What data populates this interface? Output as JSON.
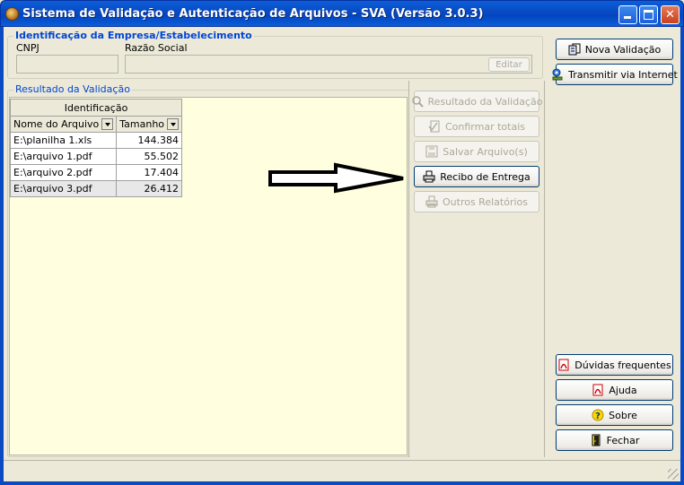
{
  "window": {
    "title": "Sistema de Validação e Autenticação de Arquivos - SVA (Versão 3.0.3)",
    "controls": {
      "minimize": "_",
      "maximize": "□",
      "close": "✕"
    }
  },
  "company_group": {
    "title": "Identificação da Empresa/Estabelecimento",
    "cnpj_label": "CNPJ",
    "cnpj_value": "",
    "razao_label": "Razão Social",
    "razao_value": "",
    "edit_button": "Editar"
  },
  "results_group": {
    "title": "Resultado da Validação",
    "table": {
      "group_header": "Identificação",
      "columns": [
        "Nome do Arquivo",
        "Tamanho"
      ],
      "rows": [
        [
          "E:\\planilha 1.xls",
          "144.384"
        ],
        [
          "E:\\arquivo 1.pdf",
          "55.502"
        ],
        [
          "E:\\arquivo 2.pdf",
          "17.404"
        ],
        [
          "E:\\arquivo 3.pdf",
          "26.412"
        ]
      ]
    }
  },
  "middle_buttons": [
    {
      "label": "Resultado da Validação",
      "icon": "magnifier-icon",
      "enabled": false
    },
    {
      "label": "Confirmar totais",
      "icon": "checkmark-doc-icon",
      "enabled": false
    },
    {
      "label": "Salvar Arquivo(s)",
      "icon": "floppy-icon",
      "enabled": false
    },
    {
      "label": "Recibo de Entrega",
      "icon": "printer-icon",
      "enabled": true
    },
    {
      "label": "Outros Relatórios",
      "icon": "printer-icon",
      "enabled": false
    }
  ],
  "right_buttons_top": [
    {
      "label": "Nova Validação",
      "icon": "documents-icon"
    },
    {
      "label": "Transmitir via Internet",
      "icon": "globe-user-icon"
    }
  ],
  "right_buttons_bottom": [
    {
      "label": "Dúvidas frequentes",
      "icon": "pdf-icon"
    },
    {
      "label": "Ajuda",
      "icon": "pdf-icon"
    },
    {
      "label": "Sobre",
      "icon": "question-icon"
    },
    {
      "label": "Fechar",
      "icon": "exit-door-icon"
    }
  ],
  "colors": {
    "titlebar": "#0a4bc4",
    "group_title": "#0046d5",
    "results_background": "#ffffe0",
    "window_background": "#ece9d8"
  }
}
